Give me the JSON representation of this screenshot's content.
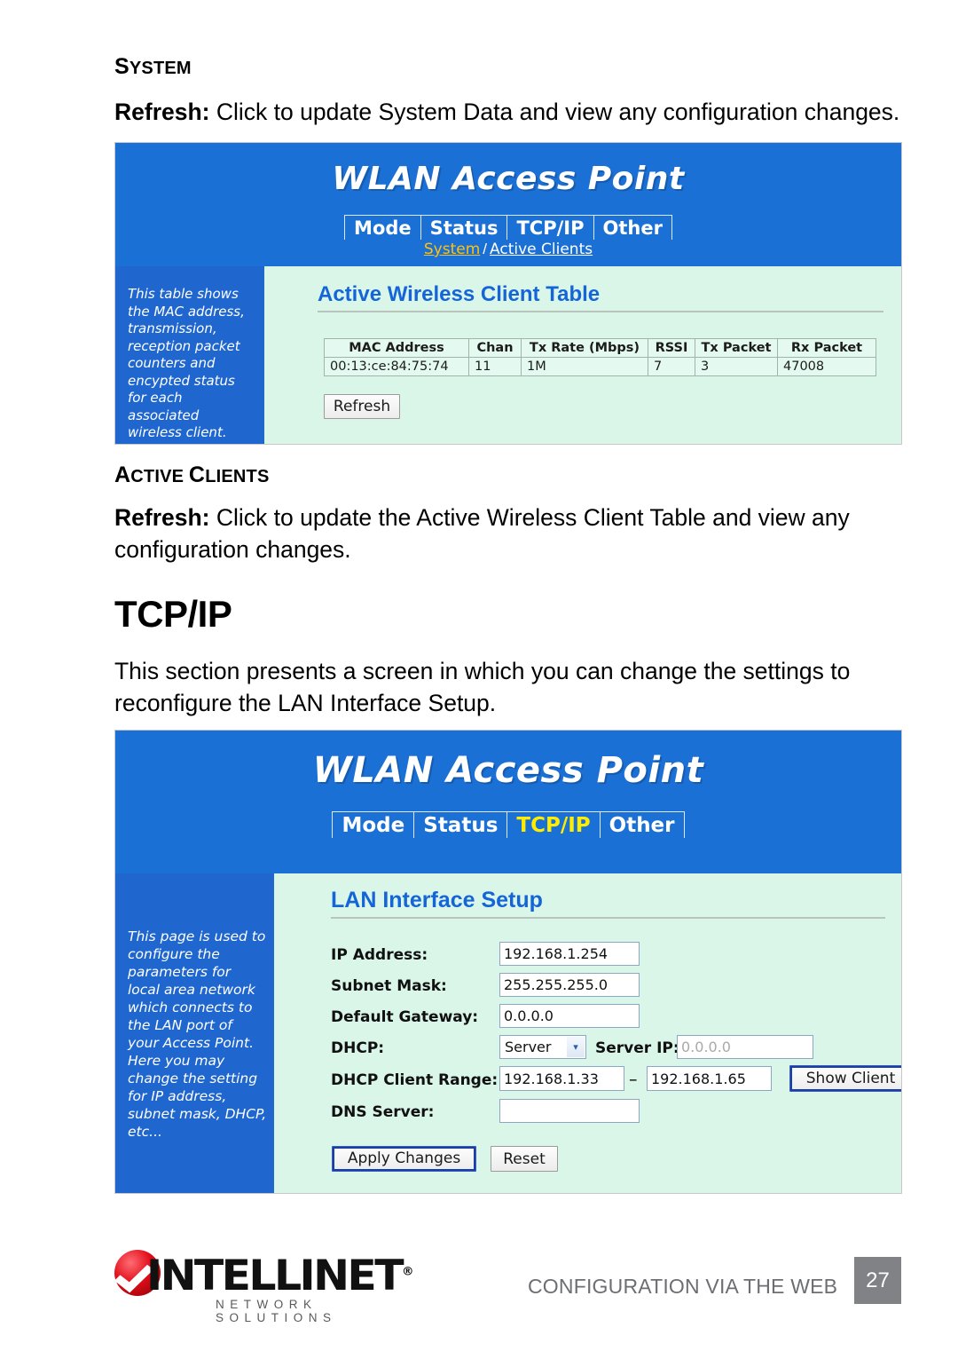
{
  "document": {
    "section_system": {
      "first": "S",
      "rest": "YSTEM"
    },
    "system_refresh_label": "Refresh:",
    "system_refresh_text": " Click to update System Data and view any configuration changes.",
    "section_active_clients": [
      {
        "first": "A",
        "rest": "CTIVE "
      },
      {
        "first": "C",
        "rest": "LIENTS"
      }
    ],
    "active_clients_refresh_label": "Refresh:",
    "active_clients_refresh_text": " Click to update the Active Wireless Client Table and view any configuration changes.",
    "tcpip_heading": "TCP/IP",
    "tcpip_paragraph": "This section presents a screen in which you can change the settings to reconfigure the LAN Interface Setup."
  },
  "screenshot1": {
    "app_title": "WLAN Access Point",
    "tabs": [
      {
        "label": "Mode",
        "active": false
      },
      {
        "label": "Status",
        "active": false
      },
      {
        "label": "TCP/IP",
        "active": false
      },
      {
        "label": "Other",
        "active": false
      }
    ],
    "subtabs": [
      {
        "label": "System",
        "current": true
      },
      {
        "label": "Active Clients",
        "current": false
      }
    ],
    "subtab_separator": "/",
    "sidebar_text": "This table shows the MAC address, transmission, reception packet counters and encypted status for each associated wireless client.",
    "panel_title": "Active Wireless Client Table",
    "table": {
      "headers": [
        "MAC Address",
        "Chan",
        "Tx Rate (Mbps)",
        "RSSI",
        "Tx Packet",
        "Rx Packet"
      ],
      "rows": [
        [
          "00:13:ce:84:75:74",
          "11",
          "1M",
          "7",
          "3",
          "47008"
        ]
      ]
    },
    "refresh_button": "Refresh"
  },
  "screenshot2": {
    "app_title": "WLAN Access Point",
    "tabs": [
      {
        "label": "Mode",
        "active": false
      },
      {
        "label": "Status",
        "active": false
      },
      {
        "label": "TCP/IP",
        "active": true
      },
      {
        "label": "Other",
        "active": false
      }
    ],
    "sidebar_text": "This page is used to configure the parameters for local area network which connects to the LAN port of your Access Point. Here you may change the setting for IP address, subnet mask, DHCP, etc...",
    "panel_title": "LAN Interface Setup",
    "fields": {
      "ip_address_label": "IP Address:",
      "ip_address_value": "192.168.1.254",
      "subnet_mask_label": "Subnet Mask:",
      "subnet_mask_value": "255.255.255.0",
      "default_gateway_label": "Default Gateway:",
      "default_gateway_value": "0.0.0.0",
      "dhcp_label": "DHCP:",
      "dhcp_value": "Server",
      "server_ip_label": "Server IP:",
      "server_ip_value": "0.0.0.0",
      "dhcp_range_label": "DHCP Client Range:",
      "dhcp_range_start": "192.168.1.33",
      "dhcp_range_separator": "–",
      "dhcp_range_end": "192.168.1.65",
      "show_client_button": "Show Client",
      "dns_server_label": "DNS Server:",
      "dns_server_value": ""
    },
    "apply_button": "Apply Changes",
    "reset_button": "Reset"
  },
  "footer": {
    "brand": "INTELLINET",
    "brand_tm": "®",
    "brand_sub": "NETWORK SOLUTIONS",
    "running_head": "CONFIGURATION VIA THE WEB",
    "page_number": "27"
  },
  "colors": {
    "header_blue": "#1b70d5",
    "sidebar_blue": "#1f66cf",
    "panel_mint": "#d9f6e9",
    "panel_title_blue": "#1565d8",
    "active_tab_yellow": "#ffec00",
    "subtab_current": "#ffc20e",
    "page_box_gray": "#808285",
    "brand_red": "#e10d18"
  }
}
